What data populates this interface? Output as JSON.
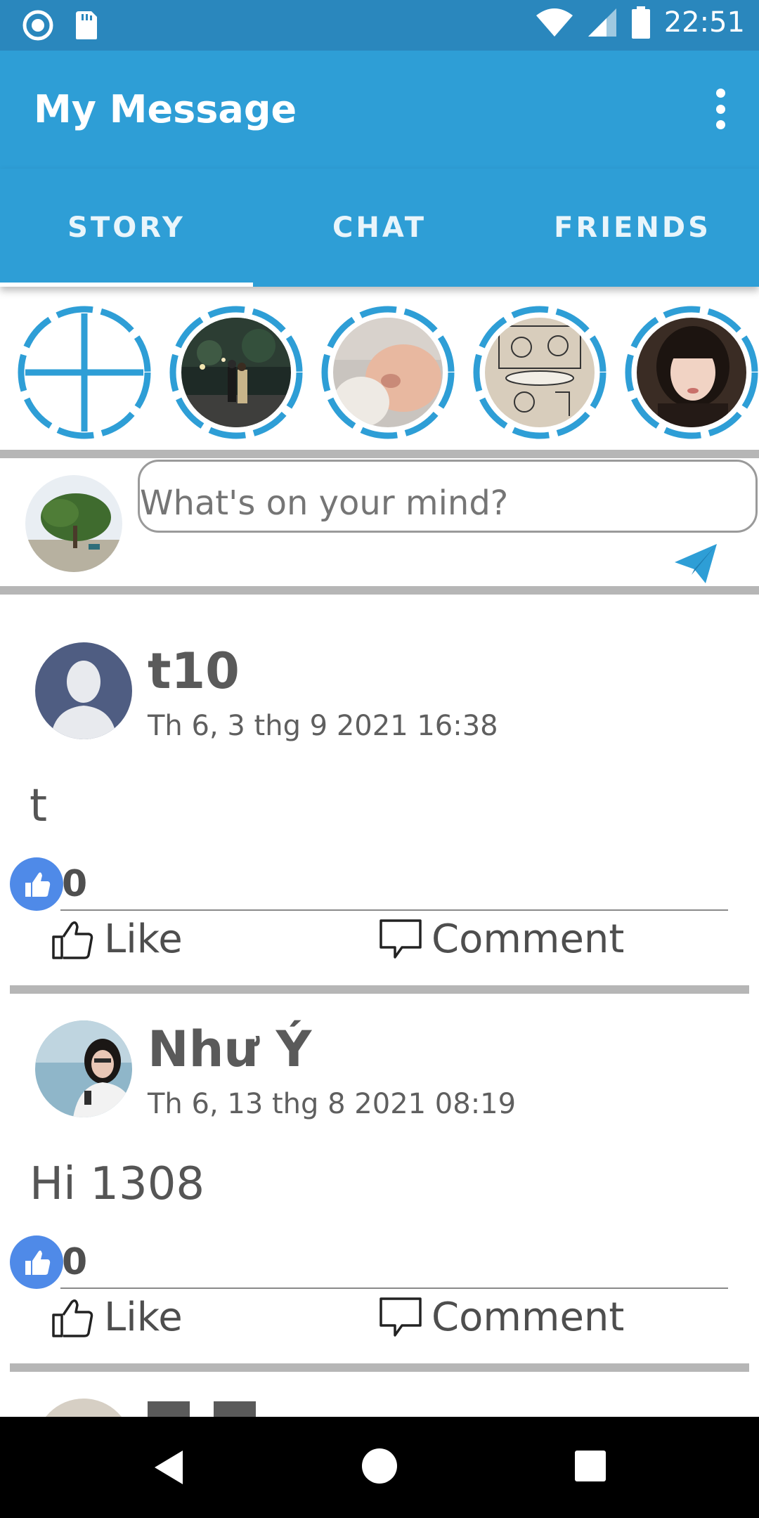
{
  "status_bar": {
    "time": "22:51",
    "icons": [
      "record-icon",
      "sd-card-icon",
      "wifi-icon",
      "signal-icon",
      "battery-icon"
    ]
  },
  "app_bar": {
    "title": "My Message",
    "menu_icon": "more-vertical-icon"
  },
  "tabs": [
    {
      "label": "STORY",
      "active": true
    },
    {
      "label": "CHAT",
      "active": false
    },
    {
      "label": "FRIENDS",
      "active": false
    }
  ],
  "stories": {
    "add_icon": "add-story-icon",
    "items": [
      "story-night-street",
      "story-baby",
      "story-comic-sketch",
      "story-girl-portrait"
    ]
  },
  "composer": {
    "placeholder": "What's on your mind?",
    "send_icon": "send-icon"
  },
  "posts": [
    {
      "author": "t10",
      "time": "Th 6, 3 thg 9 2021 16:38",
      "content": "t",
      "likes": "0",
      "like_label": "Like",
      "comment_label": "Comment"
    },
    {
      "author": "Như Ý",
      "time": "Th 6, 13 thg 8 2021 08:19",
      "content": "Hi 1308",
      "likes": "0",
      "like_label": "Like",
      "comment_label": "Comment"
    }
  ],
  "colors": {
    "status_bar": "#2a87bd",
    "primary": "#2e9ed6",
    "story_ring": "#2e9ed6",
    "like_badge": "#4f8ae8"
  }
}
